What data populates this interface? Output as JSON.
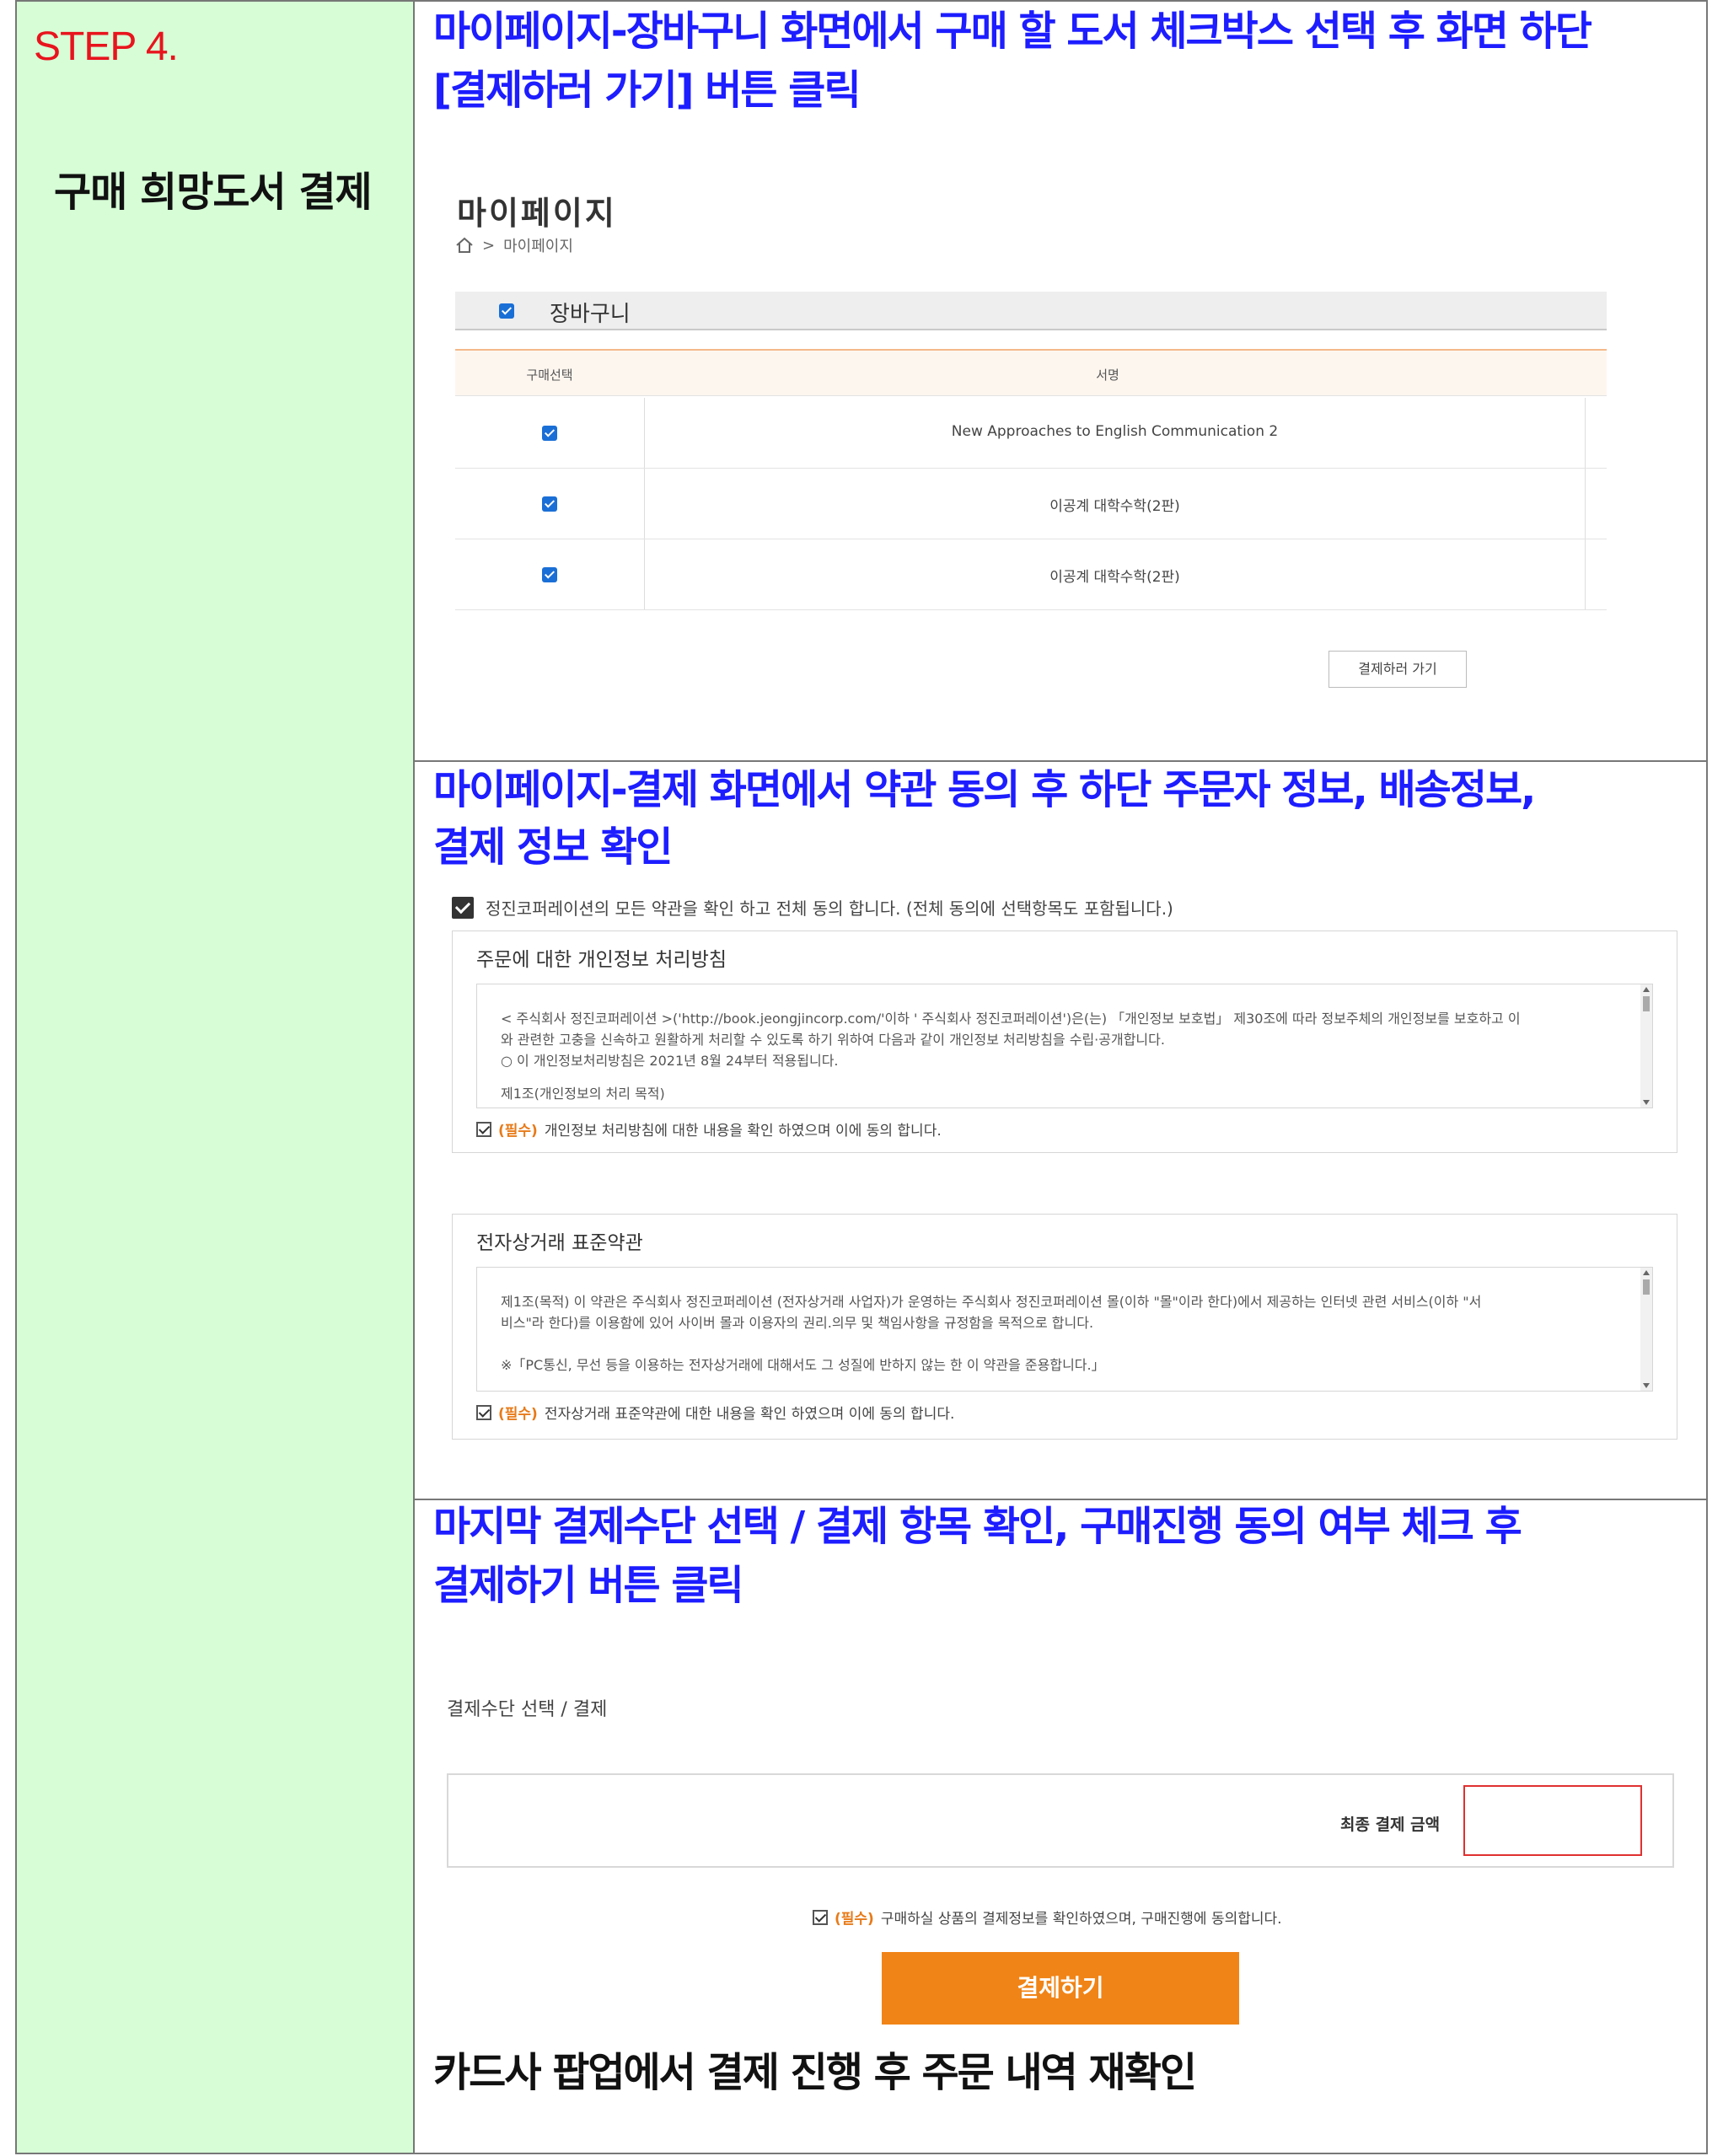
{
  "left": {
    "step": "STEP 4.",
    "title": "구매 희망도서 결제"
  },
  "section1": {
    "heading_line1": "마이페이지-장바구니 화면에서 구매 할 도서 체크박스 선택 후 화면 하단",
    "heading_line2": "[결제하러 가기] 버튼 클릭",
    "page_title": "마이페이지",
    "breadcrumb_sep": ">",
    "breadcrumb_item": "마이페이지",
    "cart_label": "장바구니",
    "columns": [
      "구매선택",
      "서명"
    ],
    "rows": [
      {
        "title": "New Approaches to English Communication 2",
        "checked": true
      },
      {
        "title": "이공계 대학수학(2판)",
        "checked": true
      },
      {
        "title": "이공계 대학수학(2판)",
        "checked": true
      }
    ],
    "checkout_button": "결제하러 가기"
  },
  "section2": {
    "heading_line1": "마이페이지-결제 화면에서 약관 동의 후 하단 주문자 정보, 배송정보,",
    "heading_line2": "결제 정보 확인",
    "agree_all": "정진코퍼레이션의 모든 약관을 확인 하고 전체 동의 합니다. (전체 동의에 선택항목도 포함됩니다.)",
    "privacy": {
      "title": "주문에 대한 개인정보 처리방침",
      "line1": "< 주식회사 정진코퍼레이션 >('http://book.jeongjincorp.com/'이하 ' 주식회사 정진코퍼레이션')은(는) 「개인정보 보호법」 제30조에 따라 정보주체의 개인정보를 보호하고 이",
      "line2": "와 관련한 고충을 신속하고 원활하게 처리할 수 있도록 하기 위하여 다음과 같이 개인정보 처리방침을 수립·공개합니다.",
      "line3": "○ 이 개인정보처리방침은 2021년 8월 24부터 적용됩니다.",
      "line4": "제1조(개인정보의 처리 목적)",
      "required": "(필수)",
      "agree": "개인정보 처리방침에 대한 내용을 확인 하였으며 이에 동의 합니다."
    },
    "terms": {
      "title": "전자상거래 표준약관",
      "line1": "제1조(목적) 이 약관은 주식회사 정진코퍼레이션 (전자상거래 사업자)가 운영하는 주식회사 정진코퍼레이션 몰(이하 \"몰\"이라 한다)에서 제공하는 인터넷 관련 서비스(이하 \"서",
      "line2": "비스\"라 한다)를 이용함에 있어 사이버 몰과 이용자의 권리.의무 및 책임사항을 규정함을 목적으로 합니다.",
      "line3": "※「PC통신, 무선 등을 이용하는 전자상거래에 대해서도 그 성질에 반하지 않는 한 이 약관을 준용합니다.」",
      "required": "(필수)",
      "agree": "전자상거래 표준약관에 대한 내용을 확인 하였으며 이에 동의 합니다."
    }
  },
  "section3": {
    "heading_line1": "마지막 결제수단 선택 / 결제 항목 확인, 구매진행 동의 여부 체크 후",
    "heading_line2": "결제하기 버튼 클릭",
    "payment_method_label": "결제수단 선택 / 결제",
    "total_label": "최종 결제 금액",
    "required": "(필수)",
    "final_agree": "구매하실 상품의 결제정보를 확인하였으며, 구매진행에 동의합니다.",
    "pay_button": "결제하기"
  },
  "section4": {
    "heading": "카드사 팝업에서 결제 진행 후 주문 내역 재확인"
  },
  "colors": {
    "heading_blue": "#1d1dff",
    "step_red": "#e8141d",
    "left_bg": "#d6fdd6",
    "pay_orange": "#f08416",
    "checkbox_blue": "#1a6fd6"
  }
}
